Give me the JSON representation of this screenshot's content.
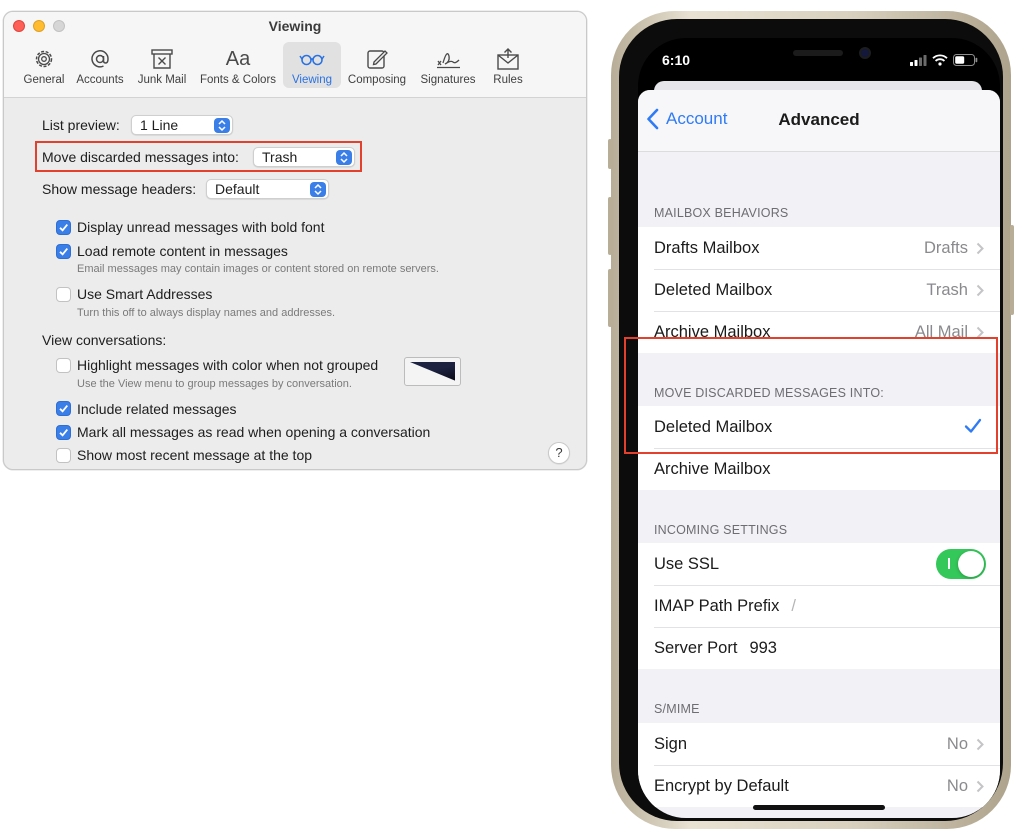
{
  "mac": {
    "window_title": "Viewing",
    "toolbar": [
      {
        "label": "General",
        "icon": "gear-icon"
      },
      {
        "label": "Accounts",
        "icon": "at-sign-icon"
      },
      {
        "label": "Junk Mail",
        "icon": "junk-mail-icon"
      },
      {
        "label": "Fonts & Colors",
        "icon": "fonts-icon"
      },
      {
        "label": "Viewing",
        "icon": "glasses-icon",
        "selected": true
      },
      {
        "label": "Composing",
        "icon": "compose-icon"
      },
      {
        "label": "Signatures",
        "icon": "signature-icon"
      },
      {
        "label": "Rules",
        "icon": "rules-icon"
      }
    ],
    "fonts_icon_text": "Aa",
    "list_preview_label": "List preview:",
    "list_preview_value": "1 Line",
    "move_discarded_label": "Move discarded messages into:",
    "move_discarded_value": "Trash",
    "show_headers_label": "Show message headers:",
    "show_headers_value": "Default",
    "options": [
      {
        "label": "Display unread messages with bold font",
        "checked": true
      },
      {
        "label": "Load remote content in messages",
        "checked": true,
        "sub": "Email messages may contain images or content stored on remote servers."
      },
      {
        "label": "Use Smart Addresses",
        "checked": false,
        "sub": "Turn this off to always display names and addresses."
      }
    ],
    "view_conversations_label": "View conversations:",
    "conversation_options": [
      {
        "label": "Highlight messages with color when not grouped",
        "checked": false,
        "sub": "Use the View menu to group messages by conversation."
      },
      {
        "label": "Include related messages",
        "checked": true
      },
      {
        "label": "Mark all messages as read when opening a conversation",
        "checked": true
      },
      {
        "label": "Show most recent message at the top",
        "checked": false
      }
    ],
    "help_label": "?",
    "accent_color": "#3a7ee8",
    "highlight_color": "#e2412d"
  },
  "iphone": {
    "time": "6:10",
    "back_label": "Account",
    "title": "Advanced",
    "sections": {
      "mailbox_behaviors": {
        "header": "MAILBOX BEHAVIORS",
        "rows": [
          {
            "label": "Drafts Mailbox",
            "value": "Drafts"
          },
          {
            "label": "Deleted Mailbox",
            "value": "Trash"
          },
          {
            "label": "Archive Mailbox",
            "value": "All Mail"
          }
        ]
      },
      "move_discarded": {
        "header": "MOVE DISCARDED MESSAGES INTO:",
        "rows": [
          {
            "label": "Deleted Mailbox",
            "selected": true
          },
          {
            "label": "Archive Mailbox",
            "selected": false
          }
        ]
      },
      "incoming": {
        "header": "INCOMING SETTINGS",
        "use_ssl_label": "Use SSL",
        "use_ssl_on": true,
        "imap_prefix_label": "IMAP Path Prefix",
        "imap_prefix_value": "/",
        "server_port_label": "Server Port",
        "server_port_value": "993"
      },
      "smime": {
        "header": "S/MIME",
        "rows": [
          {
            "label": "Sign",
            "value": "No"
          },
          {
            "label": "Encrypt by Default",
            "value": "No"
          }
        ]
      }
    },
    "tint_color": "#2f7bf6",
    "toggle_color": "#34c759"
  }
}
